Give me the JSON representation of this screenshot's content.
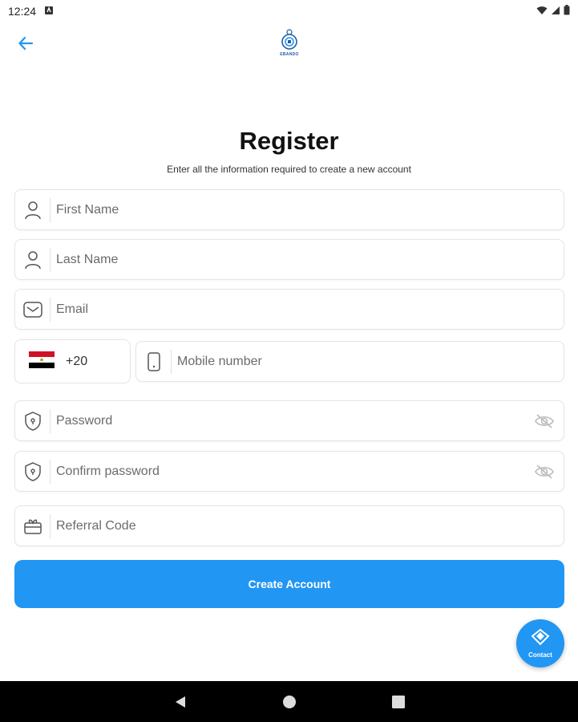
{
  "status": {
    "time": "12:24"
  },
  "header": {
    "logo_text": "EBANDO"
  },
  "page": {
    "title": "Register",
    "subtitle": "Enter all the information required to create a new account"
  },
  "form": {
    "first_name": "First Name",
    "last_name": "Last Name",
    "email": "Email",
    "country_code": "+20",
    "mobile": "Mobile number",
    "password": "Password",
    "confirm_password": "Confirm password",
    "referral": "Referral Code"
  },
  "actions": {
    "create_account": "Create Account",
    "contact": "Contact"
  },
  "colors": {
    "primary": "#2196f3",
    "icon_gray": "#6b6b6b"
  },
  "icons": {
    "back": "arrow-left-icon",
    "user": "user-icon",
    "email": "envelope-icon",
    "phone": "phone-icon",
    "password": "shield-lock-icon",
    "visibility": "eye-off-icon",
    "referral": "gift-icon",
    "contact": "handshake-icon"
  }
}
